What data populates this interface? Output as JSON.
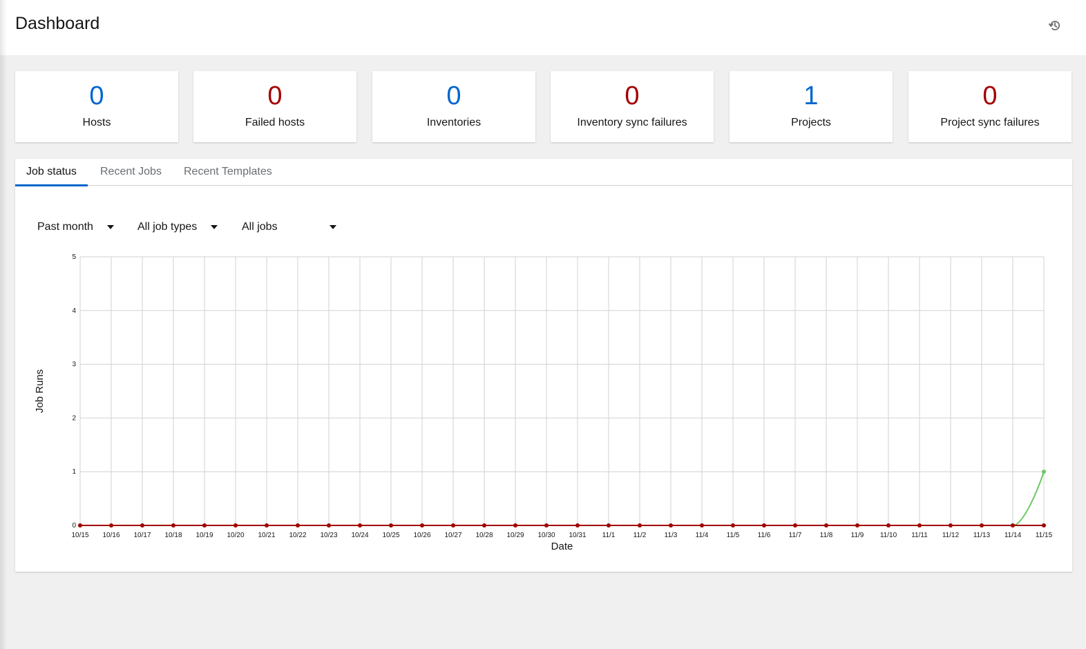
{
  "header": {
    "title": "Dashboard",
    "history_icon": "history-icon"
  },
  "counts": [
    {
      "value": "0",
      "label": "Hosts",
      "color": "#0066cc"
    },
    {
      "value": "0",
      "label": "Failed hosts",
      "color": "#a30000"
    },
    {
      "value": "0",
      "label": "Inventories",
      "color": "#0066cc"
    },
    {
      "value": "0",
      "label": "Inventory sync failures",
      "color": "#a30000"
    },
    {
      "value": "1",
      "label": "Projects",
      "color": "#0066cc"
    },
    {
      "value": "0",
      "label": "Project sync failures",
      "color": "#a30000"
    }
  ],
  "tabs": [
    {
      "label": "Job status",
      "active": true
    },
    {
      "label": "Recent Jobs",
      "active": false
    },
    {
      "label": "Recent Templates",
      "active": false
    }
  ],
  "filters": {
    "period": "Past month",
    "job_type": "All job types",
    "job_status": "All jobs"
  },
  "chart_data": {
    "type": "line",
    "xlabel": "Date",
    "ylabel": "Job Runs",
    "ylim": [
      0,
      5
    ],
    "yticks": [
      0,
      1,
      2,
      3,
      4,
      5
    ],
    "grid": true,
    "categories": [
      "10/15",
      "10/16",
      "10/17",
      "10/18",
      "10/19",
      "10/20",
      "10/21",
      "10/22",
      "10/23",
      "10/24",
      "10/25",
      "10/26",
      "10/27",
      "10/28",
      "10/29",
      "10/30",
      "10/31",
      "11/1",
      "11/2",
      "11/3",
      "11/4",
      "11/5",
      "11/6",
      "11/7",
      "11/8",
      "11/9",
      "11/10",
      "11/11",
      "11/12",
      "11/13",
      "11/14",
      "11/15"
    ],
    "series": [
      {
        "color": "#6ec664",
        "values": [
          0,
          0,
          0,
          0,
          0,
          0,
          0,
          0,
          0,
          0,
          0,
          0,
          0,
          0,
          0,
          0,
          0,
          0,
          0,
          0,
          0,
          0,
          0,
          0,
          0,
          0,
          0,
          0,
          0,
          0,
          0,
          1
        ]
      },
      {
        "color": "#a30000",
        "values": [
          0,
          0,
          0,
          0,
          0,
          0,
          0,
          0,
          0,
          0,
          0,
          0,
          0,
          0,
          0,
          0,
          0,
          0,
          0,
          0,
          0,
          0,
          0,
          0,
          0,
          0,
          0,
          0,
          0,
          0,
          0,
          0
        ]
      }
    ]
  }
}
